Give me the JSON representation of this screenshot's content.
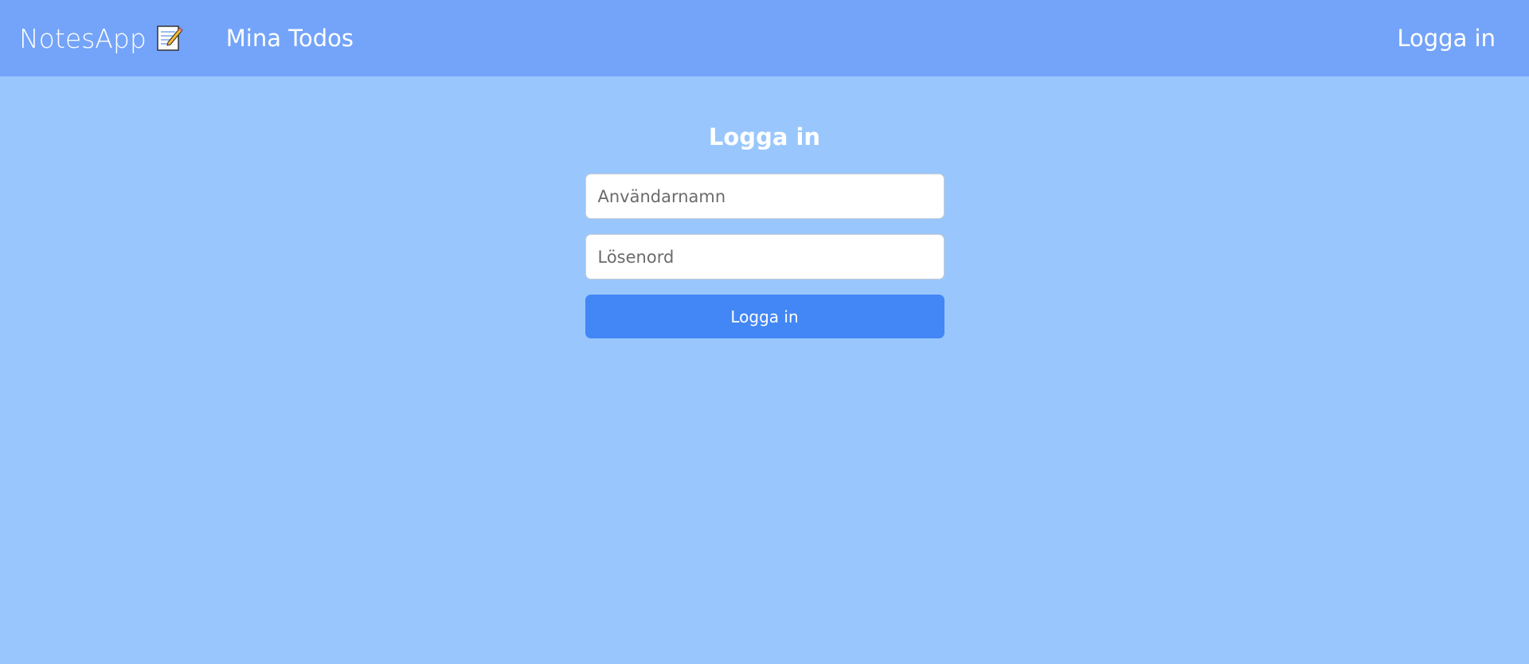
{
  "navbar": {
    "brand_label": "NotesApp",
    "brand_icon": "memo-icon",
    "todos_link": "Mina Todos",
    "login_link": "Logga in"
  },
  "login_form": {
    "title": "Logga in",
    "username_placeholder": "Användarnamn",
    "password_placeholder": "Lösenord",
    "submit_label": "Logga in"
  },
  "colors": {
    "page_background": "#99c7fd",
    "navbar_background": "#74a4f9",
    "button_background": "#4287f5",
    "text": "#ffffff"
  }
}
